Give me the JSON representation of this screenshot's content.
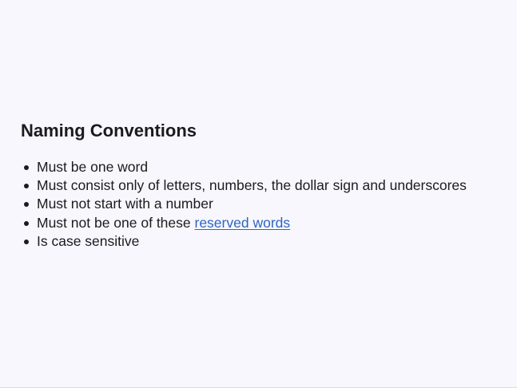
{
  "heading": "Naming Conventions",
  "items": [
    {
      "text": "Must be one word"
    },
    {
      "text": "Must consist only of letters, numbers, the dollar sign and underscores"
    },
    {
      "text": "Must not start with a number"
    },
    {
      "text": "Must not be one of these ",
      "link": "reserved words"
    },
    {
      "text": "Is case sensitive"
    }
  ],
  "colors": {
    "background": "#f7f7fd",
    "text": "#1b1b1f",
    "link": "#2e64c4"
  }
}
